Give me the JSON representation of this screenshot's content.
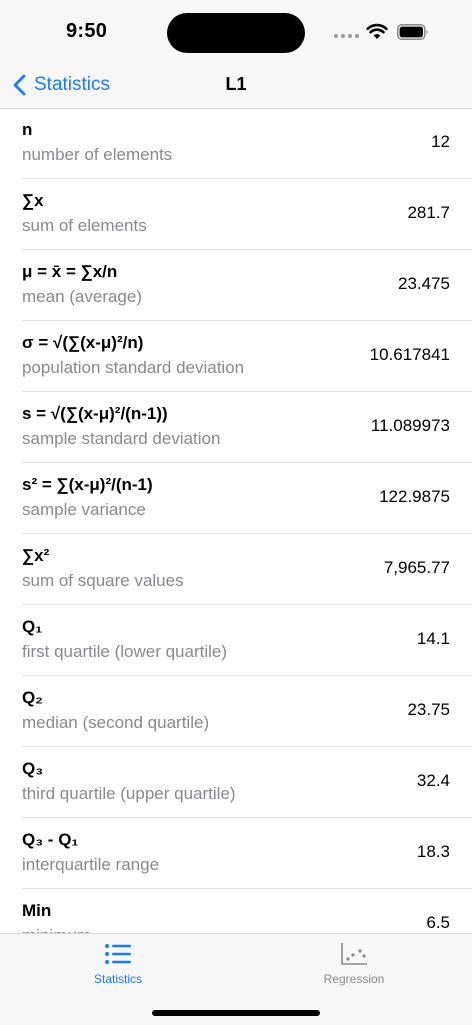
{
  "status_bar": {
    "time": "9:50",
    "icons": [
      "cellular-signal-icon",
      "wifi-icon",
      "battery-icon"
    ]
  },
  "nav": {
    "back_label": "Statistics",
    "back_icon": "chevron-left-icon",
    "title": "L1"
  },
  "colors": {
    "accent": "#1f7aff",
    "secondary_text": "#8a8a8e",
    "bar_background": "#f7f7f7"
  },
  "rows": [
    {
      "title": "n",
      "subtitle": "number of elements",
      "value": "12"
    },
    {
      "title": "∑x",
      "subtitle": "sum of elements",
      "value": "281.7"
    },
    {
      "title": "μ = x̄ = ∑x/n",
      "subtitle": "mean (average)",
      "value": "23.475"
    },
    {
      "title": "σ = √(∑(x-μ)²/n)",
      "subtitle": "population standard deviation",
      "value": "10.617841"
    },
    {
      "title": "s = √(∑(x-μ)²/(n-1))",
      "subtitle": "sample standard deviation",
      "value": "11.089973"
    },
    {
      "title": "s² = ∑(x-μ)²/(n-1)",
      "subtitle": "sample variance",
      "value": "122.9875"
    },
    {
      "title": "∑x²",
      "subtitle": "sum of square values",
      "value": "7,965.77"
    },
    {
      "title": "Q₁",
      "subtitle": "first quartile (lower quartile)",
      "value": "14.1"
    },
    {
      "title": "Q₂",
      "subtitle": "median (second quartile)",
      "value": "23.75"
    },
    {
      "title": "Q₃",
      "subtitle": "third quartile (upper quartile)",
      "value": "32.4"
    },
    {
      "title": "Q₃ - Q₁",
      "subtitle": "interquartile range",
      "value": "18.3"
    },
    {
      "title": "Min",
      "subtitle": "minimum",
      "value": "6.5"
    }
  ],
  "tabs": [
    {
      "label": "Statistics",
      "icon": "list-icon",
      "selected": true
    },
    {
      "label": "Regression",
      "icon": "scatter-plot-icon",
      "selected": false
    }
  ]
}
